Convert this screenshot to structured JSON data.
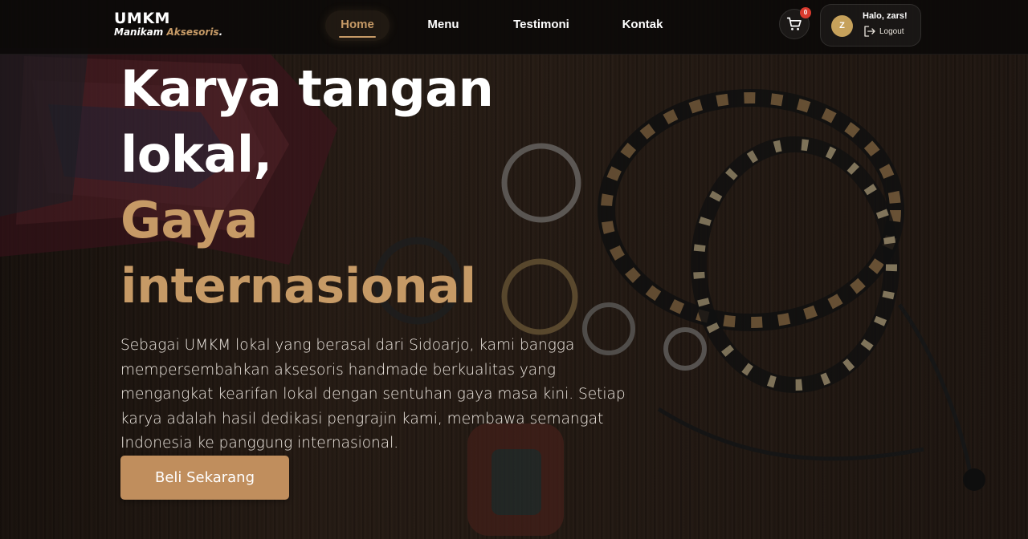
{
  "brand": {
    "title": "UMKM",
    "sub_main": "Manikam",
    "sub_accent": "Aksesoris",
    "sub_dot": "."
  },
  "nav": {
    "items": [
      {
        "label": "Home",
        "active": true
      },
      {
        "label": "Menu",
        "active": false
      },
      {
        "label": "Testimoni",
        "active": false
      },
      {
        "label": "Kontak",
        "active": false
      }
    ]
  },
  "cart": {
    "count": "0",
    "icon": "cart-icon"
  },
  "user": {
    "initial": "Z",
    "greeting": "Halo, zars!",
    "logout_label": "Logout",
    "logout_icon": "logout-icon"
  },
  "hero": {
    "headline_line1": "Karya tangan",
    "headline_line2": "lokal,",
    "headline_line3": "Gaya",
    "headline_line4": "internasional",
    "description": "Sebagai UMKM lokal yang berasal dari Sidoarjo, kami bangga mempersembahkan aksesoris handmade berkualitas yang mengangkat kearifan lokal dengan sentuhan gaya masa kini. Setiap karya adalah hasil dedikasi pengrajin kami, membawa semangat Indonesia ke panggung internasional.",
    "cta_label": "Beli Sekarang"
  },
  "colors": {
    "accent": "#c69a66",
    "cta": "#c08e5d",
    "badge": "#d93a2e",
    "avatar": "#c6a15b",
    "navbar": "#0c0a09"
  }
}
